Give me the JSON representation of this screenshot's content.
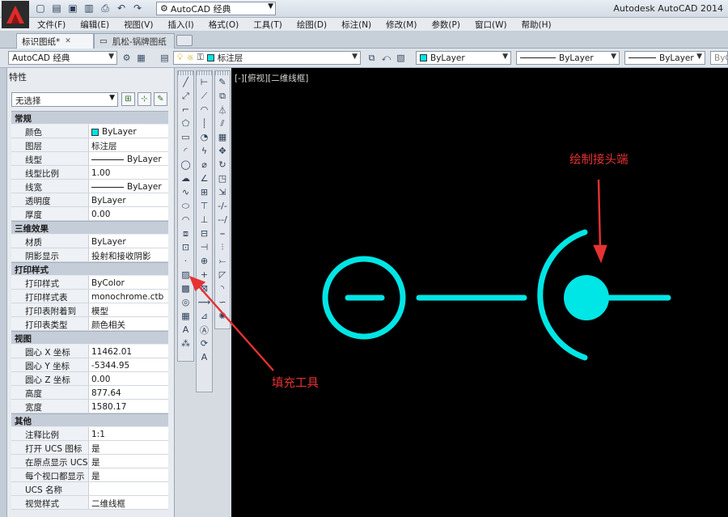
{
  "titlebar": {
    "workspace": "AutoCAD 经典",
    "app_title": "Autodesk AutoCAD 2014"
  },
  "menu": [
    "文件(F)",
    "编辑(E)",
    "视图(V)",
    "插入(I)",
    "格式(O)",
    "工具(T)",
    "绘图(D)",
    "标注(N)",
    "修改(M)",
    "参数(P)",
    "窗口(W)",
    "帮助(H)"
  ],
  "tabs": [
    {
      "label": "标识图纸*",
      "active": true
    },
    {
      "label": "肌松-锅牌图纸",
      "active": false
    }
  ],
  "toolbar": {
    "workspace_combo": "AutoCAD 经典",
    "layer_combo": "标注层",
    "color_combo": "ByLayer",
    "linetype_combo": "ByLayer",
    "lineweight_combo": "ByLayer",
    "plotstyle_combo": "ByCo",
    "accent_color": "#00e5e5"
  },
  "palette": {
    "title": "特性",
    "selection": "无选择",
    "sections": [
      {
        "name": "常规",
        "rows": [
          {
            "k": "颜色",
            "v": "ByLayer",
            "swatch": true
          },
          {
            "k": "图层",
            "v": "标注层"
          },
          {
            "k": "线型",
            "v": "ByLayer",
            "line": true
          },
          {
            "k": "线型比例",
            "v": "1.00"
          },
          {
            "k": "线宽",
            "v": "ByLayer",
            "line": true
          },
          {
            "k": "透明度",
            "v": "ByLayer"
          },
          {
            "k": "厚度",
            "v": "0.00"
          }
        ]
      },
      {
        "name": "三维效果",
        "rows": [
          {
            "k": "材质",
            "v": "ByLayer"
          },
          {
            "k": "阴影显示",
            "v": "投射和接收阴影"
          }
        ]
      },
      {
        "name": "打印样式",
        "rows": [
          {
            "k": "打印样式",
            "v": "ByColor"
          },
          {
            "k": "打印样式表",
            "v": "monochrome.ctb"
          },
          {
            "k": "打印表附着到",
            "v": "模型"
          },
          {
            "k": "打印表类型",
            "v": "颜色相关"
          }
        ]
      },
      {
        "name": "视图",
        "rows": [
          {
            "k": "圆心 X 坐标",
            "v": "11462.01"
          },
          {
            "k": "圆心 Y 坐标",
            "v": "-5344.95"
          },
          {
            "k": "圆心 Z 坐标",
            "v": "0.00"
          },
          {
            "k": "高度",
            "v": "877.64"
          },
          {
            "k": "宽度",
            "v": "1580.17"
          }
        ]
      },
      {
        "name": "其他",
        "rows": [
          {
            "k": "注释比例",
            "v": "1:1"
          },
          {
            "k": "打开 UCS 图标",
            "v": "是"
          },
          {
            "k": "在原点显示 UCS...",
            "v": "是"
          },
          {
            "k": "每个视口都显示 ...",
            "v": "是"
          },
          {
            "k": "UCS 名称",
            "v": ""
          },
          {
            "k": "视觉样式",
            "v": "二维线框"
          }
        ]
      }
    ]
  },
  "viewport": {
    "label": "[-][俯视][二维线框]",
    "annotation_connector": "绘制接头端",
    "annotation_fill_tool": "填充工具",
    "draw_color": "#00e5e5",
    "annotation_color": "#e63232"
  }
}
